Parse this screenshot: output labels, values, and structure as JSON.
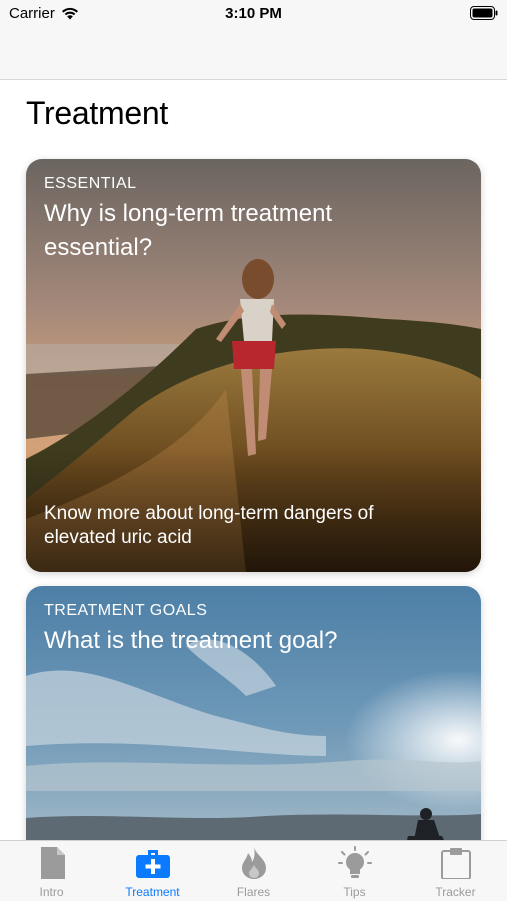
{
  "status_bar": {
    "carrier": "Carrier",
    "time": "3:10 PM"
  },
  "page": {
    "title": "Treatment"
  },
  "cards": [
    {
      "tag": "ESSENTIAL",
      "headline": "Why is long-term treatment essential?",
      "description": "Know more about long-term dangers of elevated uric acid"
    },
    {
      "tag": "TREATMENT GOALS",
      "headline": "What is the treatment goal?",
      "description": ""
    }
  ],
  "tab_bar": {
    "accent_color": "#0a7bff",
    "inactive_color": "#9b9b9b",
    "items": [
      {
        "label": "Intro",
        "icon": "document-icon"
      },
      {
        "label": "Treatment",
        "icon": "medical-kit-icon",
        "active": true
      },
      {
        "label": "Flares",
        "icon": "flame-icon"
      },
      {
        "label": "Tips",
        "icon": "lightbulb-icon"
      },
      {
        "label": "Tracker",
        "icon": "clipboard-icon"
      }
    ]
  }
}
